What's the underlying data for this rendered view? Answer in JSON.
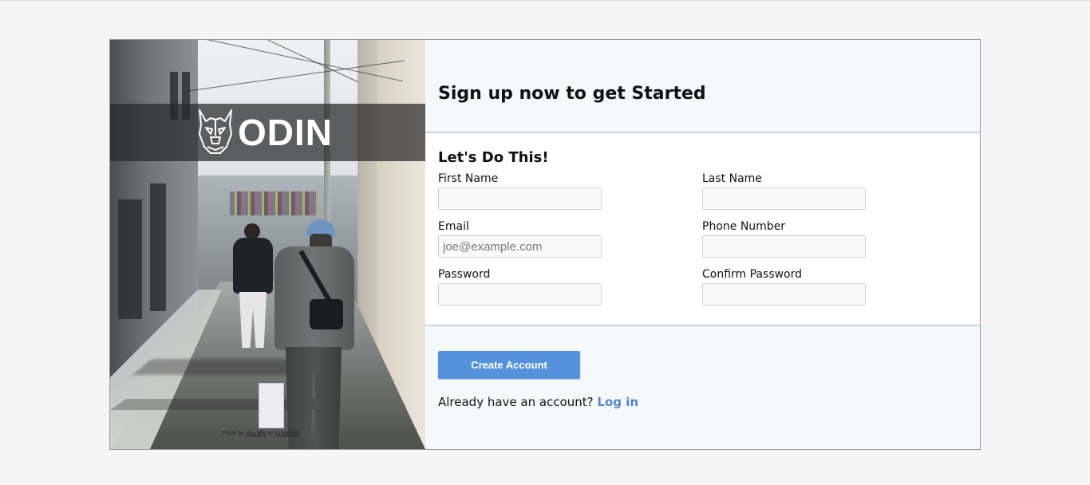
{
  "brand": {
    "name": "ODIN",
    "photo_credit_prefix": "Photo by",
    "photo_credit_author": "vlog tiffv",
    "photo_credit_mid": "on",
    "photo_credit_site": "Unsplash"
  },
  "header": {
    "title": "Sign up now to get Started"
  },
  "form": {
    "section_title": "Let's Do This!",
    "first_name": {
      "label": "First Name",
      "value": "",
      "placeholder": ""
    },
    "last_name": {
      "label": "Last Name",
      "value": "",
      "placeholder": ""
    },
    "email": {
      "label": "Email",
      "value": "",
      "placeholder": "joe@example.com"
    },
    "phone": {
      "label": "Phone Number",
      "value": "",
      "placeholder": ""
    },
    "password": {
      "label": "Password",
      "value": "",
      "placeholder": ""
    },
    "confirm_password": {
      "label": "Confirm Password",
      "value": "",
      "placeholder": ""
    }
  },
  "footer": {
    "create_button_label": "Create Account",
    "login_prompt": "Already have an account?",
    "login_link": "Log in"
  },
  "colors": {
    "accent": "#5592dc",
    "link": "#4f86c6",
    "panel_bg": "#f6f9fc",
    "divider": "#c7d6e4",
    "brand_band": "#282828"
  },
  "icons": {
    "brand_logo": "odin-viking-dog-icon"
  }
}
